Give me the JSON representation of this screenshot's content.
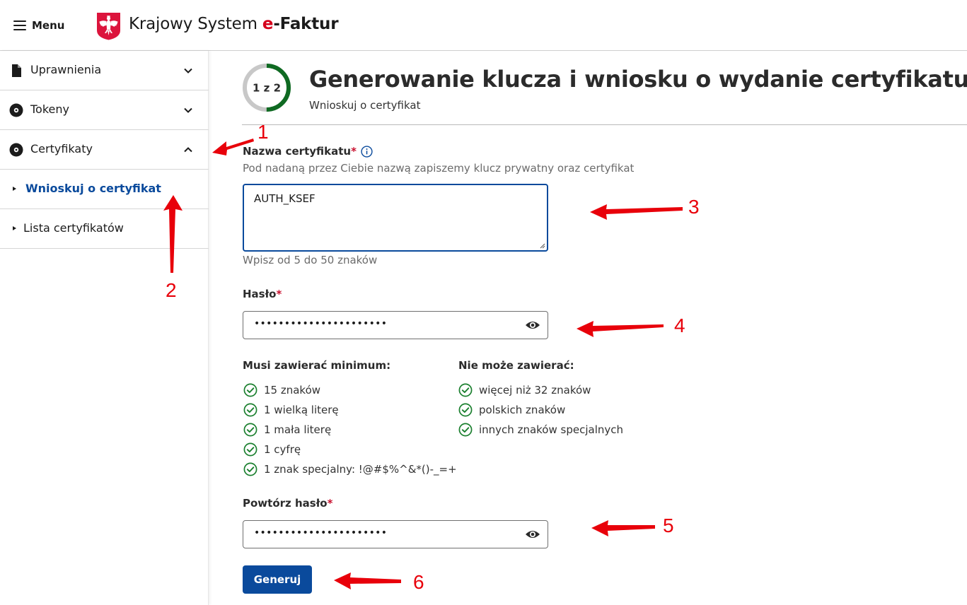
{
  "header": {
    "menu_label": "Menu",
    "brand_prefix": "Krajowy System ",
    "brand_e": "e",
    "brand_suffix": "-Faktur"
  },
  "sidebar": {
    "items": [
      {
        "label": "Uprawnienia",
        "icon": "document-icon",
        "state": "collapsed"
      },
      {
        "label": "Tokeny",
        "icon": "disc-icon",
        "state": "collapsed"
      },
      {
        "label": "Certyfikaty",
        "icon": "disc-icon",
        "state": "expanded"
      }
    ],
    "subitems": [
      {
        "label": "Wnioskuj o certyfikat",
        "active": true
      },
      {
        "label": "Lista certyfikatów",
        "active": false
      }
    ]
  },
  "stepper": {
    "label": "1 z 2",
    "progress": 0.5,
    "color_done": "#0f6a22",
    "color_todo": "#c8c8c8"
  },
  "page": {
    "title": "Generowanie klucza i wniosku o wydanie certyfikatu",
    "subtitle": "Wnioskuj o certyfikat"
  },
  "form": {
    "cert_name": {
      "label": "Nazwa certyfikatu",
      "required_mark": "*",
      "hint": "Pod nadaną przez Ciebie nazwą zapiszemy klucz prywatny oraz certyfikat",
      "value": "AUTH_KSEF",
      "help": "Wpisz od 5 do 50 znaków"
    },
    "password": {
      "label": "Hasło",
      "required_mark": "*",
      "value_masked": "••••••••••••••••••••••"
    },
    "rules_must": {
      "heading": "Musi zawierać minimum:",
      "items": [
        "15 znaków",
        "1 wielką literę",
        "1 mała literę",
        "1 cyfrę",
        "1 znak specjalny: !@#$%^&*()-_=+"
      ]
    },
    "rules_cannot": {
      "heading": "Nie może zawierać:",
      "items": [
        "więcej niż 32 znaków",
        "polskich znaków",
        "innych znaków specjalnych"
      ]
    },
    "repeat_password": {
      "label": "Powtórz hasło",
      "required_mark": "*",
      "value_masked": "••••••••••••••••••••••"
    },
    "submit_label": "Generuj"
  },
  "annotations": {
    "color": "#e8000a",
    "numbers": [
      "1",
      "2",
      "3",
      "4",
      "5",
      "6"
    ]
  },
  "colors": {
    "primary": "#0a4a9c",
    "required": "#c8102e",
    "success": "#1a7f2e",
    "brand_red": "#d5001c"
  }
}
